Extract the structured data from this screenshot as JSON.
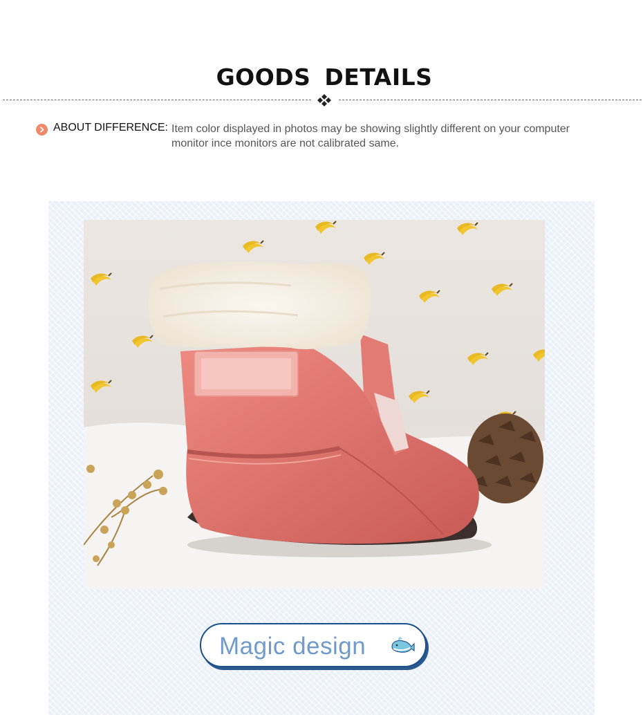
{
  "header": {
    "title": "GOODS  DETAILS"
  },
  "note": {
    "label": "ABOUT DIFFERENCE:",
    "text": "Item color displayed in photos may be showing slightly different on your computer monitor ince monitors are not calibrated same."
  },
  "banner": {
    "label": "Magic design"
  },
  "icons": {
    "divider": "diamond-cluster-icon",
    "note": "arrow-circle-icon",
    "banner": "whale-icon"
  },
  "colors": {
    "panel_background": "#e9f0f7",
    "boot": "#e0736c",
    "note_icon": "#f08a6a",
    "banner_text": "#6f9ac9",
    "banner_border": "#1a4f8a"
  }
}
